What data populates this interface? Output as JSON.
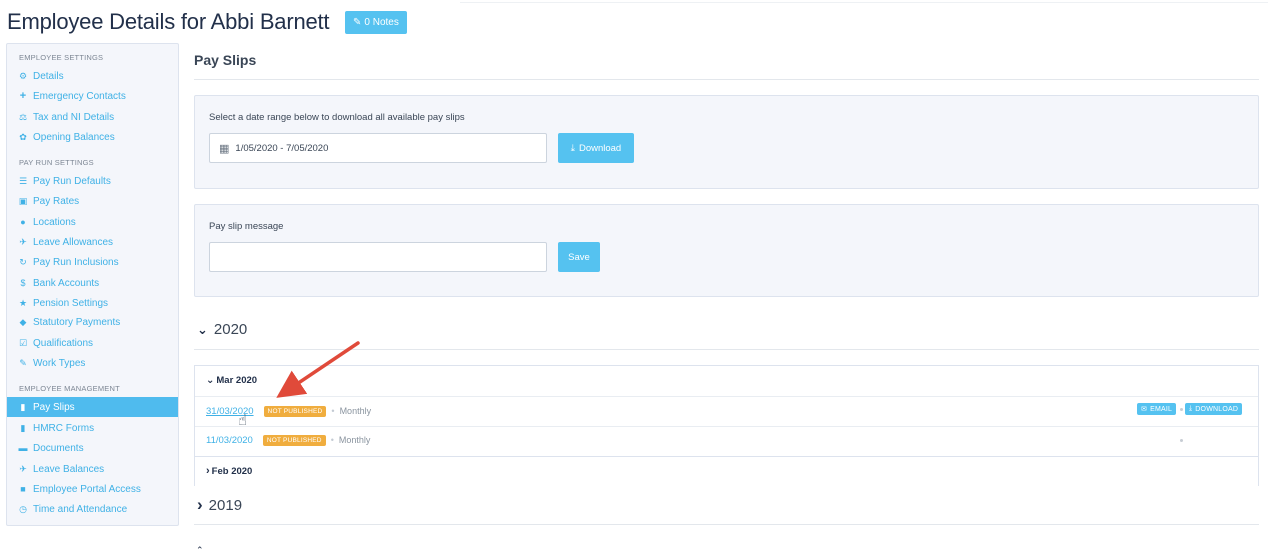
{
  "page": {
    "title": "Employee Details for Abbi Barnett",
    "notes_label": "0 Notes"
  },
  "sidebar": {
    "sections": [
      {
        "label": "EMPLOYEE SETTINGS"
      },
      {
        "label": "PAY RUN SETTINGS"
      },
      {
        "label": "EMPLOYEE MANAGEMENT"
      }
    ],
    "items": [
      {
        "label": "Details",
        "icon": "gear-icon"
      },
      {
        "label": "Emergency Contacts",
        "icon": "plus-icon"
      },
      {
        "label": "Tax and NI Details",
        "icon": "scale-icon"
      },
      {
        "label": "Opening Balances",
        "icon": "leaf-icon"
      },
      {
        "label": "Pay Run Defaults",
        "icon": "list-icon"
      },
      {
        "label": "Pay Rates",
        "icon": "money-icon"
      },
      {
        "label": "Locations",
        "icon": "globe-icon"
      },
      {
        "label": "Leave Allowances",
        "icon": "plane-icon"
      },
      {
        "label": "Pay Run Inclusions",
        "icon": "refresh-icon"
      },
      {
        "label": "Bank Accounts",
        "icon": "dollar-circle-icon"
      },
      {
        "label": "Pension Settings",
        "icon": "star-icon"
      },
      {
        "label": "Statutory Payments",
        "icon": "tag-icon"
      },
      {
        "label": "Qualifications",
        "icon": "check-square-icon"
      },
      {
        "label": "Work Types",
        "icon": "pencil-icon"
      },
      {
        "label": "Pay Slips",
        "icon": "file-icon",
        "active": true
      },
      {
        "label": "HMRC Forms",
        "icon": "file-icon"
      },
      {
        "label": "Documents",
        "icon": "folder-icon"
      },
      {
        "label": "Leave Balances",
        "icon": "plane-icon"
      },
      {
        "label": "Employee Portal Access",
        "icon": "lock-icon"
      },
      {
        "label": "Time and Attendance",
        "icon": "clock-icon"
      }
    ]
  },
  "main": {
    "heading": "Pay Slips",
    "download_panel": {
      "label": "Select a date range below to download all available pay slips",
      "date_range": "1/05/2020 - 7/05/2020",
      "download_label": "Download"
    },
    "message_panel": {
      "label": "Pay slip message",
      "value": "",
      "save_label": "Save"
    },
    "years": [
      {
        "label": "2020",
        "months": [
          {
            "label": "Mar 2020",
            "slips": [
              {
                "date": "31/03/2020",
                "status": "NOT PUBLISHED",
                "frequency": "Monthly",
                "email_label": "EMAIL",
                "download_label": "DOWNLOAD"
              },
              {
                "date": "11/03/2020",
                "status": "NOT PUBLISHED",
                "frequency": "Monthly"
              }
            ]
          },
          {
            "label": "Feb 2020"
          }
        ]
      },
      {
        "label": "2019"
      }
    ]
  },
  "colors": {
    "accent": "#55c2f0",
    "link": "#3fb1e6",
    "badge": "#f0ad3e",
    "annotation_arrow": "#e04a3a"
  }
}
